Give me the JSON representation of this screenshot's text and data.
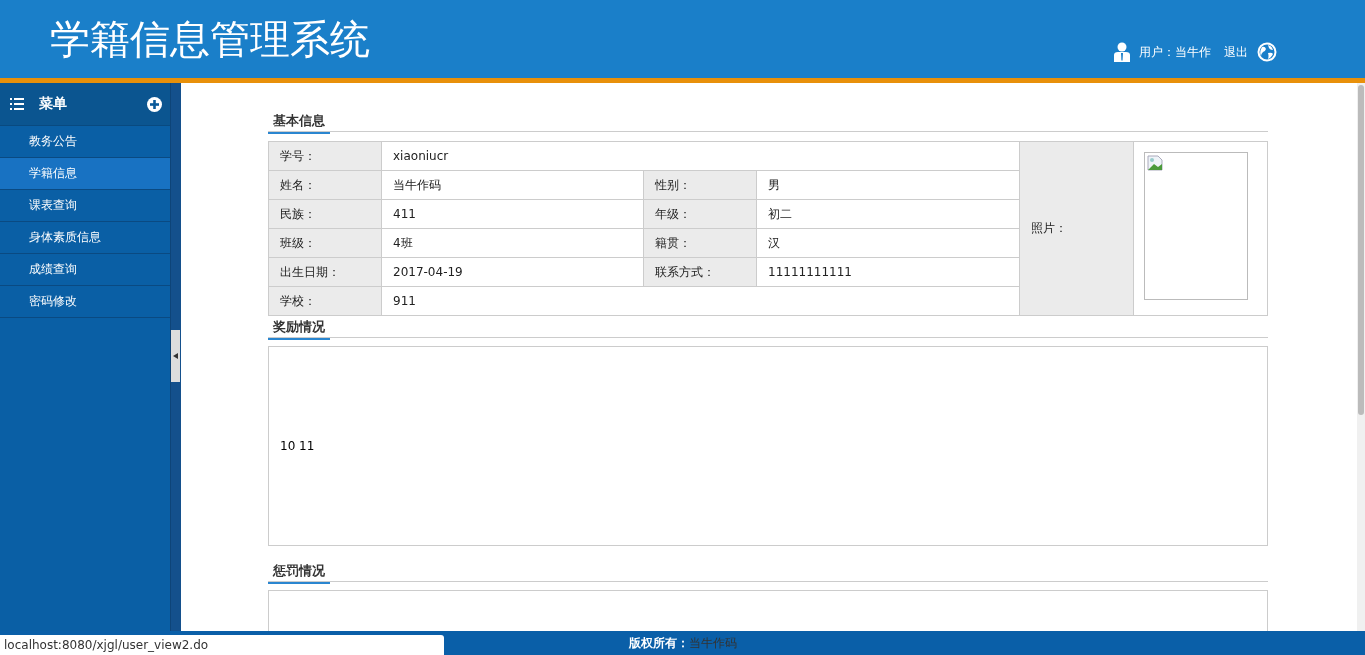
{
  "header": {
    "title": "学籍信息管理系统",
    "user_label": "用户：当牛作",
    "logout": "退出"
  },
  "sidebar": {
    "title": "菜单",
    "items": [
      {
        "label": "教务公告",
        "selected": false
      },
      {
        "label": "学籍信息",
        "selected": true
      },
      {
        "label": "课表查询",
        "selected": false
      },
      {
        "label": "身体素质信息",
        "selected": false
      },
      {
        "label": "成绩查询",
        "selected": false
      },
      {
        "label": "密码修改",
        "selected": false
      }
    ]
  },
  "basic_info": {
    "title": "基本信息",
    "photo_label": "照片：",
    "rows": [
      {
        "label": "学号：",
        "value": "xiaoniucr"
      },
      {
        "label": "姓名：",
        "value": "当牛作码",
        "label2": "性别：",
        "value2": "男"
      },
      {
        "label": "民族：",
        "value": "411",
        "label2": "年级：",
        "value2": "初二"
      },
      {
        "label": "班级：",
        "value": "4班",
        "label2": "籍贯：",
        "value2": "汉"
      },
      {
        "label": "出生日期：",
        "value": "2017-04-19",
        "label2": "联系方式：",
        "value2": "11111111111"
      },
      {
        "label": "学校：",
        "value": "911"
      }
    ]
  },
  "awards": {
    "title": "奖励情况",
    "text": "10 11"
  },
  "punishments": {
    "title": "惩罚情况"
  },
  "footer": {
    "label": "版权所有：",
    "owner": "当牛作码"
  },
  "status_url": "localhost:8080/xjgl/user_view2.do"
}
